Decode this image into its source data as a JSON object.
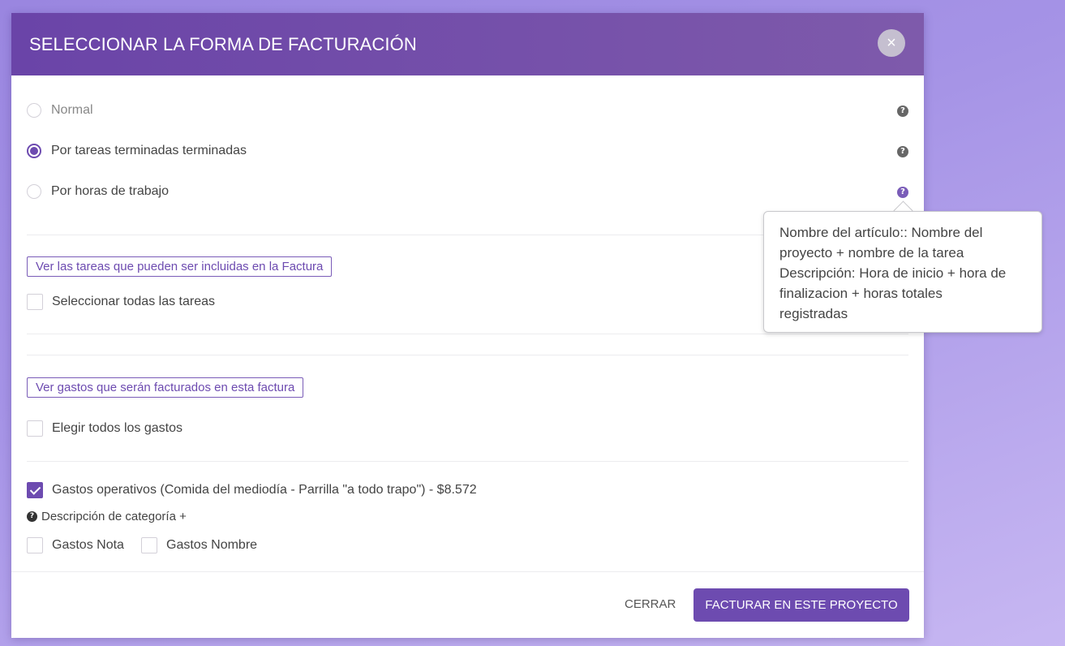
{
  "modal": {
    "title": "SELECCIONAR LA FORMA DE FACTURACIÓN",
    "close_icon": "×"
  },
  "billing_options": [
    {
      "label": "Normal",
      "selected": false,
      "disabled": true
    },
    {
      "label": "Por tareas terminadas terminadas",
      "selected": true,
      "disabled": false
    },
    {
      "label": "Por horas de trabajo",
      "selected": false,
      "disabled": false
    }
  ],
  "help_icon": "?",
  "tasks_section": {
    "link_label": "Ver las tareas que pueden ser incluidas en la Factura",
    "select_all_label": "Seleccionar todas las tareas"
  },
  "expenses_section": {
    "link_label": "Ver gastos que serán facturados en esta factura",
    "select_all_label": "Elegir todos los gastos",
    "expense_item_label": "Gastos operativos (Comida del mediodía - Parrilla \"a todo trapo\") - $8.572",
    "category_description": "Descripción de categoría +",
    "note_label": "Gastos Nota",
    "name_label": "Gastos Nombre"
  },
  "tooltip": {
    "lines": [
      "Nombre del artículo:: Nombre del",
      "proyecto + nombre de la tarea",
      "Descripción: Hora de inicio + hora de",
      "finalizacion + horas totales",
      "registradas"
    ]
  },
  "footer": {
    "close_label": "CERRAR",
    "submit_label": "FACTURAR EN ESTE PROYECTO"
  },
  "colors": {
    "accent": "#6d4bb0",
    "header_start": "#6a44a8",
    "header_end": "#7e5aab",
    "background": "#a593e6"
  }
}
